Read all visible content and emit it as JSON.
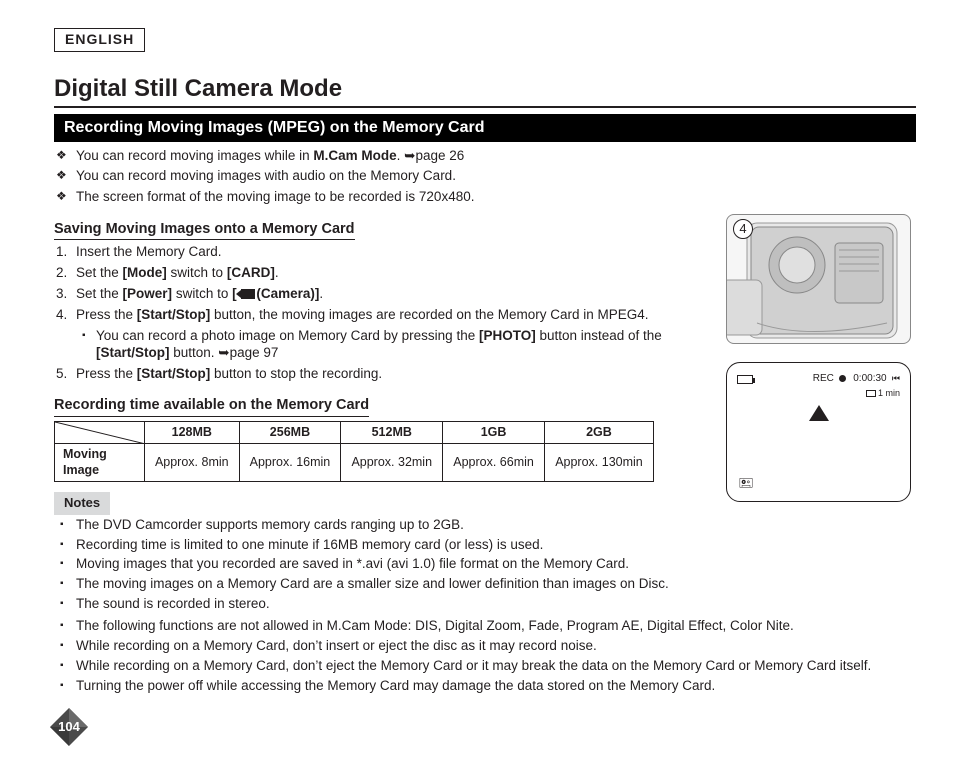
{
  "language": "ENGLISH",
  "page_title": "Digital Still Camera Mode",
  "section_heading": "Recording Moving Images (MPEG) on the Memory Card",
  "intro": {
    "line1a": "You can record moving images while in ",
    "line1b": "M.Cam Mode",
    "line1c": ". ",
    "line1_ref": "page 26",
    "line2": "You can record moving images with audio on the Memory Card.",
    "line3": "The screen format of the moving image to be recorded is 720x480."
  },
  "saving_heading": "Saving Moving Images onto a Memory Card",
  "steps": {
    "s1": "Insert the Memory Card.",
    "s2a": "Set the ",
    "s2b": "[Mode]",
    "s2c": " switch to ",
    "s2d": "[CARD]",
    "s2e": ".",
    "s3a": "Set the ",
    "s3b": "[Power]",
    "s3c": " switch to ",
    "s3d": "[",
    "s3e": "(Camera)]",
    "s3f": ".",
    "s4a": "Press the ",
    "s4b": "[Start/Stop]",
    "s4c": " button, the moving images are recorded on the Memory Card in MPEG4.",
    "s4sub_a": "You can record a photo image on Memory Card by pressing the ",
    "s4sub_b": "[PHOTO]",
    "s4sub_c": " button instead of the ",
    "s4sub_d": "[Start/Stop]",
    "s4sub_e": " button. ",
    "s4sub_ref": "page 97",
    "s5a": "Press the ",
    "s5b": "[Start/Stop]",
    "s5c": " button to stop the recording."
  },
  "table_heading": "Recording time available on the Memory Card",
  "table": {
    "row_label": "Moving Image",
    "cols": [
      "128MB",
      "256MB",
      "512MB",
      "1GB",
      "2GB"
    ],
    "vals": [
      "Approx. 8min",
      "Approx. 16min",
      "Approx. 32min",
      "Approx. 66min",
      "Approx. 130min"
    ]
  },
  "notes_label": "Notes",
  "notes_narrow": [
    "The DVD Camcorder supports memory cards ranging up to 2GB.",
    "Recording time is limited to one minute if 16MB memory card (or less) is used.",
    "Moving images that you recorded are saved in *.avi (avi 1.0) file format on the Memory Card.",
    "The moving images on a Memory Card are a smaller size and lower definition than images on Disc.",
    "The sound is recorded in stereo."
  ],
  "notes_wide": [
    "The following functions are not allowed in M.Cam Mode: DIS, Digital Zoom, Fade, Program AE, Digital Effect, Color Nite.",
    "While recording on a Memory Card, don’t insert or eject the disc as it may record noise.",
    "While recording on a Memory Card, don’t eject the Memory Card or it may break the data on the Memory Card or Memory Card itself.",
    "Turning the power off while accessing the Memory Card may damage the data stored on the Memory Card."
  ],
  "page_number": "104",
  "step_callout": "4",
  "screen": {
    "rec": "REC",
    "time": "0:00:30",
    "remaining": "1 min"
  }
}
